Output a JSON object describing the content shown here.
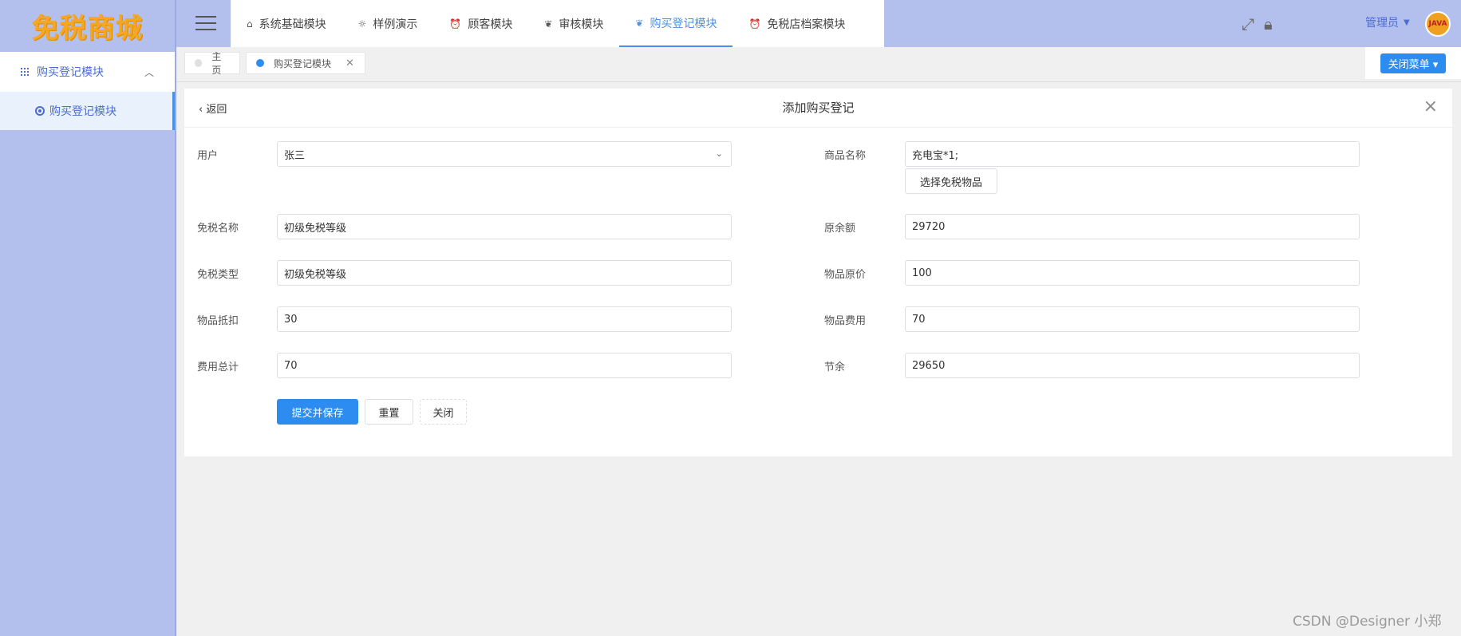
{
  "sidebar": {
    "logo": "免税商城",
    "group_label": "购买登记模块",
    "sub_label": "购买登记模块"
  },
  "topbar": {
    "tabs": [
      {
        "label": "系统基础模块",
        "icon": "home-icon"
      },
      {
        "label": "样例演示",
        "icon": "sun-icon"
      },
      {
        "label": "顾客模块",
        "icon": "alarm-icon"
      },
      {
        "label": "审核模块",
        "icon": "leaf-icon"
      },
      {
        "label": "购买登记模块",
        "icon": "leaf-icon",
        "active": true
      },
      {
        "label": "免税店档案模块",
        "icon": "alarm-icon"
      }
    ],
    "user": "管理员",
    "avatar_text": "JAVA"
  },
  "tagbar": {
    "tags": [
      {
        "label": "主页"
      },
      {
        "label": "购买登记模块",
        "closable": true
      }
    ],
    "close_menu": "关闭菜单"
  },
  "card": {
    "back": "返回",
    "title": "添加购买登记"
  },
  "form": {
    "user_label": "用户",
    "user_value": "张三",
    "goods_name_label": "商品名称",
    "goods_name_value": "充电宝*1;",
    "select_goods_button": "选择免税物品",
    "tax_free_name_label": "免税名称",
    "tax_free_name_value": "初级免税等级",
    "original_balance_label": "原余额",
    "original_balance_value": "29720",
    "tax_free_type_label": "免税类型",
    "tax_free_type_value": "初级免税等级",
    "original_price_label": "物品原价",
    "original_price_value": "100",
    "discount_label": "物品抵扣",
    "discount_value": "30",
    "item_cost_label": "物品费用",
    "item_cost_value": "70",
    "total_cost_label": "费用总计",
    "total_cost_value": "70",
    "savings_label": "节余",
    "savings_value": "29650",
    "submit_button": "提交并保存",
    "reset_button": "重置",
    "close_button": "关闭"
  },
  "watermark": "CSDN @Designer 小郑",
  "colors": {
    "sidebar_bg": "#b3c0ee",
    "primary": "#2d8cf0",
    "logo": "#f5a623"
  }
}
